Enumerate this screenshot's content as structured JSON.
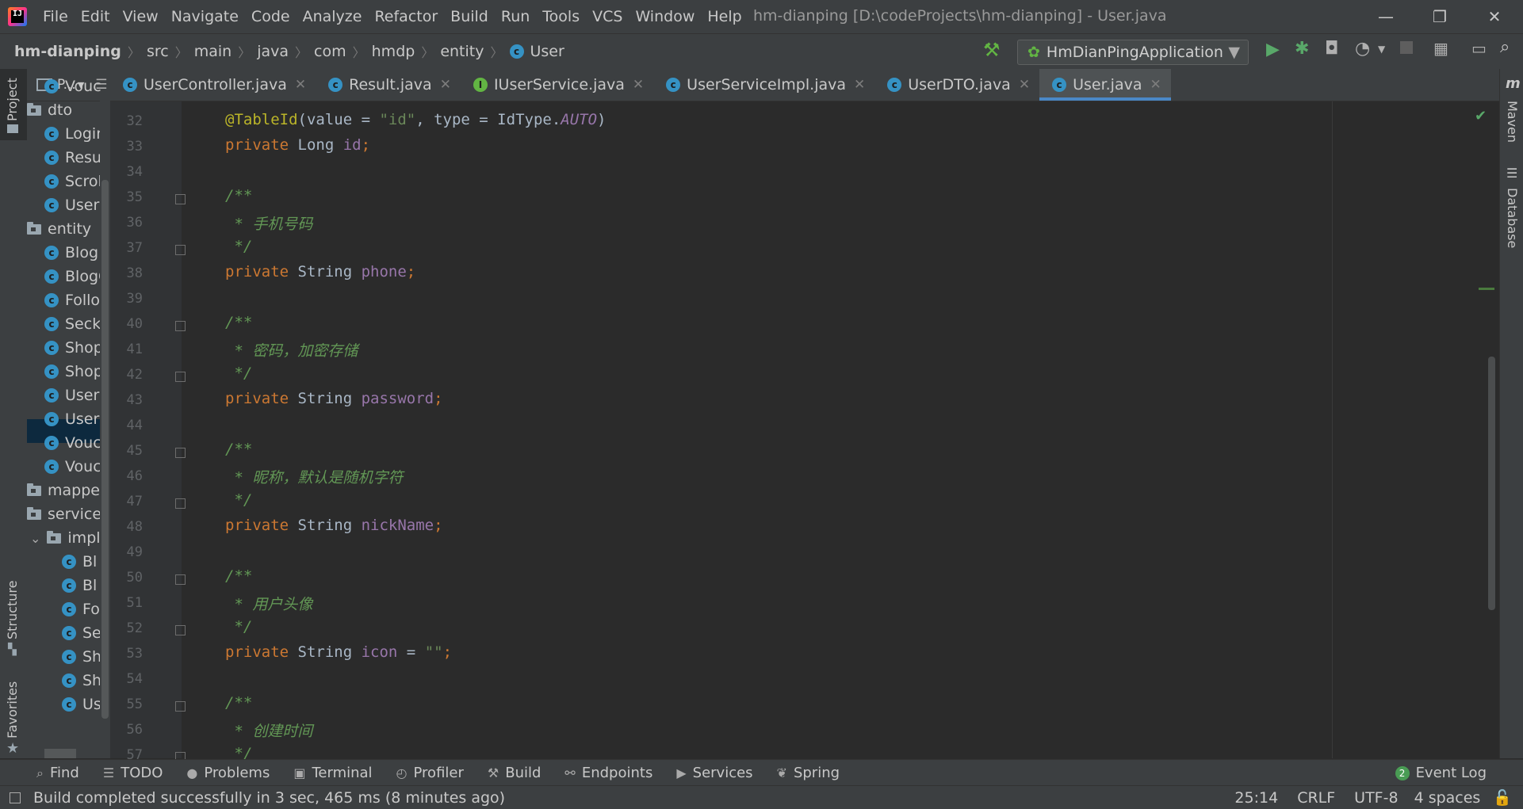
{
  "menu": {
    "items": [
      "File",
      "Edit",
      "View",
      "Navigate",
      "Code",
      "Analyze",
      "Refactor",
      "Build",
      "Run",
      "Tools",
      "VCS",
      "Window",
      "Help"
    ],
    "title": "hm-dianping [D:\\codeProjects\\hm-dianping] - User.java"
  },
  "breadcrumb": [
    "hm-dianping",
    "src",
    "main",
    "java",
    "com",
    "hmdp",
    "entity",
    "User"
  ],
  "run_config": "HmDianPingApplication",
  "left_strip": {
    "project": "Project",
    "structure": "Structure",
    "favorites": "Favorites"
  },
  "right_strip": {
    "maven": "Maven",
    "database": "Database"
  },
  "project_panel": {
    "header": "P...",
    "rows": [
      {
        "type": "class",
        "label": "Vouc"
      },
      {
        "type": "folder",
        "label": "dto"
      },
      {
        "type": "class",
        "label": "Login"
      },
      {
        "type": "class",
        "label": "Resul"
      },
      {
        "type": "class",
        "label": "Scrol"
      },
      {
        "type": "class",
        "label": "UserD"
      },
      {
        "type": "folder",
        "label": "entity"
      },
      {
        "type": "class",
        "label": "Blog"
      },
      {
        "type": "class",
        "label": "BlogC"
      },
      {
        "type": "class",
        "label": "Follo"
      },
      {
        "type": "class",
        "label": "Secki"
      },
      {
        "type": "class",
        "label": "Shop"
      },
      {
        "type": "class",
        "label": "ShopT"
      },
      {
        "type": "class",
        "label": "User"
      },
      {
        "type": "class",
        "label": "UserI"
      },
      {
        "type": "class",
        "label": "Vouc"
      },
      {
        "type": "class",
        "label": "Vouc"
      },
      {
        "type": "folder",
        "label": "mapper"
      },
      {
        "type": "folder",
        "label": "service"
      },
      {
        "type": "folder",
        "label": "impl"
      },
      {
        "type": "class",
        "label": "Bl"
      },
      {
        "type": "class",
        "label": "Bl"
      },
      {
        "type": "class",
        "label": "Fo"
      },
      {
        "type": "class",
        "label": "Se"
      },
      {
        "type": "class",
        "label": "Sh"
      },
      {
        "type": "class",
        "label": "Sh"
      },
      {
        "type": "class",
        "label": "Us"
      }
    ]
  },
  "tabs": [
    {
      "label": "UserController.java",
      "icon": "c",
      "active": false
    },
    {
      "label": "Result.java",
      "icon": "c",
      "active": false
    },
    {
      "label": "IUserService.java",
      "icon": "i",
      "active": false
    },
    {
      "label": "UserServiceImpl.java",
      "icon": "c",
      "active": false
    },
    {
      "label": "UserDTO.java",
      "icon": "c",
      "active": false
    },
    {
      "label": "User.java",
      "icon": "c",
      "active": true
    }
  ],
  "code": {
    "lines": [
      "32",
      "33",
      "34",
      "35",
      "36",
      "37",
      "38",
      "39",
      "40",
      "41",
      "42",
      "43",
      "44",
      "45",
      "46",
      "47",
      "48",
      "49",
      "50",
      "51",
      "52",
      "53",
      "54",
      "55",
      "56",
      "57"
    ],
    "ann_tableid": "@TableId",
    "tableid_args_open": "(value = ",
    "tableid_str": "\"id\"",
    "tableid_mid": ", type = IdType.",
    "tableid_auto": "AUTO",
    "tableid_close": ")",
    "kw_private": "private",
    "type_long": " Long ",
    "type_string": " String ",
    "field_id": "id",
    "field_phone": "phone",
    "field_password": "password",
    "field_nickname": "nickName",
    "field_icon": "icon",
    "semi": ";",
    "assign": " = ",
    "empty_str": "\"\"",
    "doc_open": "/**",
    "doc_close": " */",
    "doc_phone": " * 手机号码",
    "doc_password": " * 密码，加密存储",
    "doc_nickname": " * 昵称，默认是随机字符",
    "doc_icon": " * 用户头像",
    "doc_create": " * 创建时间"
  },
  "tool_windows": [
    "Find",
    "TODO",
    "Problems",
    "Terminal",
    "Profiler",
    "Build",
    "Endpoints",
    "Services",
    "Spring"
  ],
  "event_log": {
    "count": "2",
    "label": "Event Log"
  },
  "status": {
    "message": "Build completed successfully in 3 sec, 465 ms (8 minutes ago)",
    "position": "25:14",
    "line_sep": "CRLF",
    "encoding": "UTF-8",
    "indent": "4 spaces"
  },
  "colors": {
    "accent": "#4a88c7",
    "class_icon": "#3592c4",
    "interface_icon": "#62b543",
    "keyword": "#cc7832",
    "annotation": "#bbb529",
    "string": "#6a8759",
    "field": "#9876aa",
    "doc": "#629755"
  }
}
